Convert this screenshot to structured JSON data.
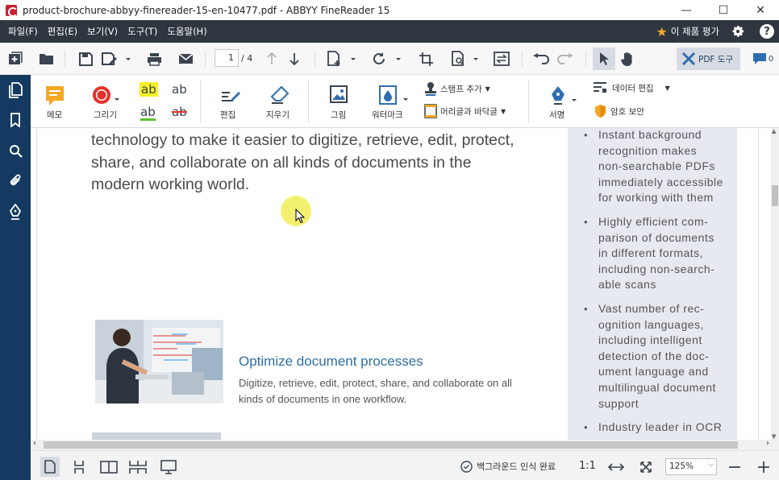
{
  "window": {
    "title": "product-brochure-abbyy-finereader-15-en-10477.pdf - ABBYY FineReader 15",
    "minimize": "—",
    "maximize": "☐",
    "close": "✕"
  },
  "menu": {
    "items": [
      "파일(F)",
      "편집(E)",
      "보기(V)",
      "도구(T)",
      "도움말(H)"
    ],
    "rate_label": "이 제품 평가"
  },
  "toolbar": {
    "page_current": "1",
    "page_total": "/ 4",
    "pdf_tools_label": "PDF 도구",
    "comments_count": "0"
  },
  "ribbon": {
    "memo": "메모",
    "draw": "그리기",
    "highlight": "ab",
    "underline": "ab",
    "insert_text": "ab",
    "strike": "ab",
    "edit": "편집",
    "erase": "지우기",
    "image": "그림",
    "watermark": "워터마크",
    "stamp": "스탬프 추가",
    "header_footer": "머리글과 바닥글",
    "sign": "서명",
    "data_edit": "데이터 편집",
    "password": "암호 보안"
  },
  "document": {
    "body_lines": [
      "technology to make it easier to digitize, retrieve, edit, protect,",
      "share, and collaborate on all kinds of documents in the",
      "modern working world."
    ],
    "section_title": "Optimize document processes",
    "section_desc_lines": [
      "Digitize, retrieve, edit, protect, share, and collaborate on all",
      "kinds of documents in one workflow."
    ],
    "bullets": [
      [
        "Instant background",
        "recognition makes",
        "non-searchable PDFs",
        "immediately accessible",
        "for working with them"
      ],
      [
        "Highly efficient com-",
        "parison of documents",
        "in different formats,",
        "including non-search-",
        "able scans"
      ],
      [
        "Vast number of rec-",
        "ognition languages,",
        "including intelligent",
        "detection of the doc-",
        "ument language and",
        "multilingual document",
        "support"
      ],
      [
        "Industry leader in OCR"
      ]
    ]
  },
  "status": {
    "recognition_text": "백그라운드 인식 완료",
    "ratio": "1:1",
    "zoom": "125%"
  },
  "colors": {
    "menubar": "#2f3640",
    "sidebar": "#153a61",
    "accent_blue": "#2d6fa3",
    "sidebox": "#e6e9f0"
  }
}
